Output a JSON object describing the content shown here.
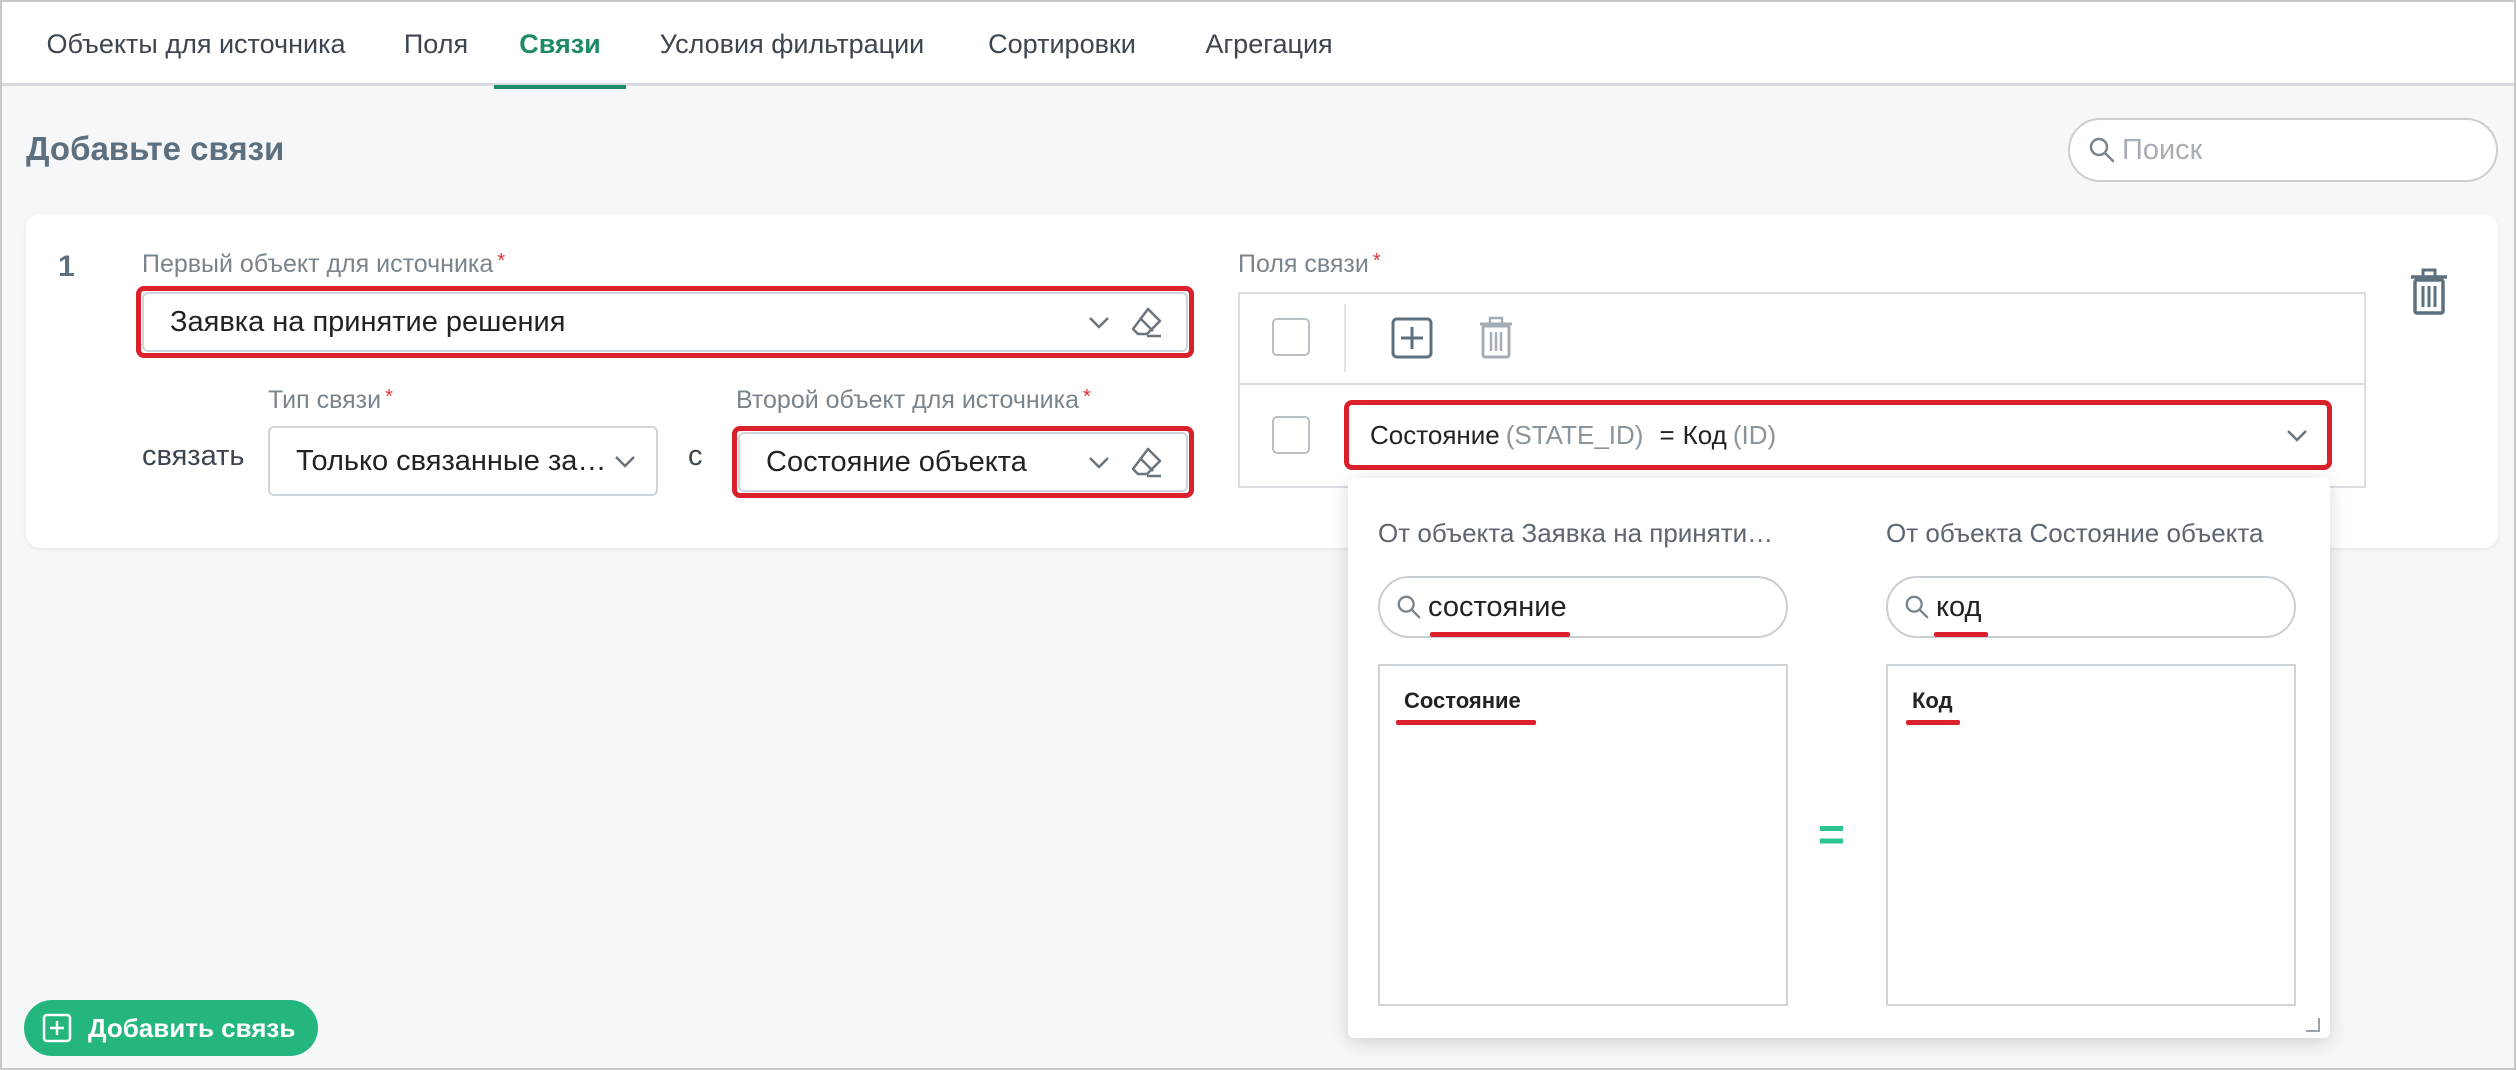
{
  "tabs": [
    {
      "label": "Объекты для источника",
      "active": false
    },
    {
      "label": "Поля",
      "active": false
    },
    {
      "label": "Связи",
      "active": true
    },
    {
      "label": "Условия фильтрации",
      "active": false
    },
    {
      "label": "Сортировки",
      "active": false
    },
    {
      "label": "Агрегация",
      "active": false
    }
  ],
  "page": {
    "title": "Добавьте связи",
    "search_placeholder": "Поиск"
  },
  "link": {
    "number": "1",
    "first_object_label": "Первый объект для источника",
    "first_object_value": "Заявка на принятие решения",
    "link_type_label": "Тип связи",
    "link_type_value": "Только связанные записи",
    "connect_text": "связать",
    "with_text": "с",
    "second_object_label": "Второй объект для источника",
    "second_object_value": "Состояние объекта",
    "fields_label": "Поля связи",
    "required_mark": "*",
    "pair": {
      "left_field": "Состояние",
      "left_code": "(STATE_ID)",
      "equals": "=",
      "right_field": "Код",
      "right_code": "(ID)"
    }
  },
  "dropdown": {
    "left_header": "От объекта Заявка на приняти…",
    "left_search_value": "состояние",
    "left_items": [
      "Состояние"
    ],
    "equals": "=",
    "right_header": "От объекта Состояние объекта",
    "right_search_value": "код",
    "right_items": [
      "Код"
    ]
  },
  "add_button_label": "Добавить связь",
  "colors": {
    "accent": "#1f8a66",
    "button": "#25b67e",
    "highlight": "#d9202b",
    "equals": "#2cc58f"
  }
}
